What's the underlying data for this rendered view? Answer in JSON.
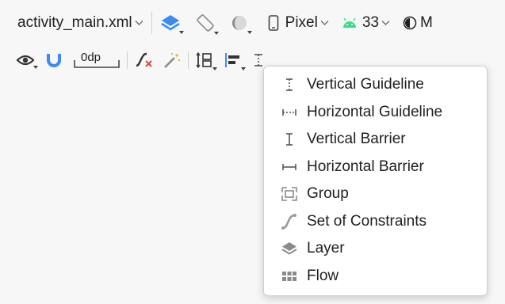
{
  "toolbar_top": {
    "file": "activity_main.xml",
    "device": "Pixel",
    "api": "33",
    "theme_letter": "M"
  },
  "toolbar_bottom": {
    "margin": "0dp"
  },
  "menu": {
    "items": [
      {
        "label": "Vertical Guideline",
        "icon": "vertical-guideline-icon"
      },
      {
        "label": "Horizontal Guideline",
        "icon": "horizontal-guideline-icon"
      },
      {
        "label": "Vertical Barrier",
        "icon": "vertical-barrier-icon"
      },
      {
        "label": "Horizontal Barrier",
        "icon": "horizontal-barrier-icon"
      },
      {
        "label": "Group",
        "icon": "group-icon"
      },
      {
        "label": "Set of Constraints",
        "icon": "constraint-set-icon"
      },
      {
        "label": "Layer",
        "icon": "layer-icon"
      },
      {
        "label": "Flow",
        "icon": "flow-icon"
      }
    ]
  },
  "colors": {
    "accent_blue": "#3d8af7",
    "android_green": "#3ddc84",
    "error_red": "#e0463e"
  }
}
